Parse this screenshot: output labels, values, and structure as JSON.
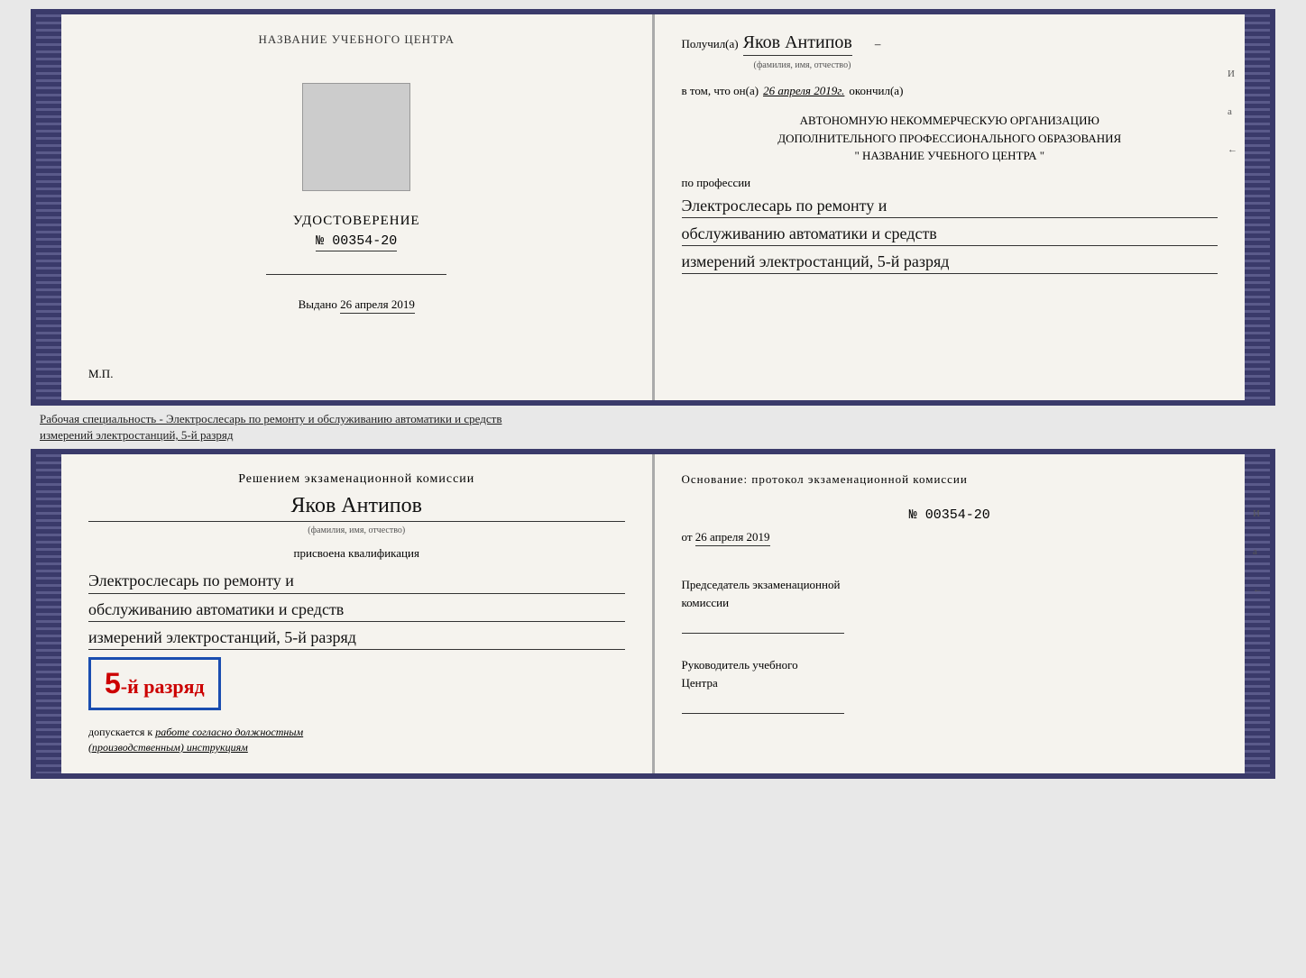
{
  "top_book": {
    "left": {
      "header": "НАЗВАНИЕ УЧЕБНОГО ЦЕНТРА",
      "cert_label": "УДОСТОВЕРЕНИЕ",
      "cert_number": "№ 00354-20",
      "issued_prefix": "Выдано",
      "issued_date": "26 апреля 2019",
      "mp_label": "М.П."
    },
    "right": {
      "received_prefix": "Получил(а)",
      "received_name": "Яков Антипов",
      "name_sub": "(фамилия, имя, отчество)",
      "in_that_prefix": "в том, что он(а)",
      "date_value": "26 апреля 2019г.",
      "finished_label": "окончил(а)",
      "org_line1": "АВТОНОМНУЮ НЕКОММЕРЧЕСКУЮ ОРГАНИЗАЦИЮ",
      "org_line2": "ДОПОЛНИТЕЛЬНОГО ПРОФЕССИОНАЛЬНОГО ОБРАЗОВАНИЯ",
      "org_line3": "\"  НАЗВАНИЕ УЧЕБНОГО ЦЕНТРА  \"",
      "profession_prefix": "по профессии",
      "profession_line1": "Электрослесарь по ремонту и",
      "profession_line2": "обслуживанию автоматики и средств",
      "profession_line3": "измерений электростанций, 5-й разряд"
    }
  },
  "annotation": {
    "line1": "Рабочая специальность - Электрослесарь по ремонту и обслуживанию автоматики и средств",
    "line2": "измерений электростанций, 5-й разряд"
  },
  "bottom_book": {
    "left": {
      "decision_text": "Решением экзаменационной комиссии",
      "name": "Яков Антипов",
      "name_sub": "(фамилия, имя, отчество)",
      "qualification_label": "присвоена квалификация",
      "profession_line1": "Электрослесарь по ремонту и",
      "profession_line2": "обслуживанию автоматики и средств",
      "profession_line3": "измерений электростанций, 5-й разряд",
      "grade_number": "5",
      "grade_suffix": "-й разряд",
      "allowed_prefix": "допускается к",
      "allowed_text": "работе согласно должностным",
      "instructions": "(производственным) инструкциям"
    },
    "right": {
      "basis_label": "Основание: протокол экзаменационной комиссии",
      "protocol_number": "№  00354-20",
      "date_prefix": "от",
      "date_value": "26 апреля 2019",
      "chairman_label": "Председатель экзаменационной",
      "commission_label": "комиссии",
      "director_label": "Руководитель учебного",
      "center_label": "Центра"
    }
  },
  "side_marks": {
    "mark1": "И",
    "mark2": "а",
    "mark3": "←"
  }
}
